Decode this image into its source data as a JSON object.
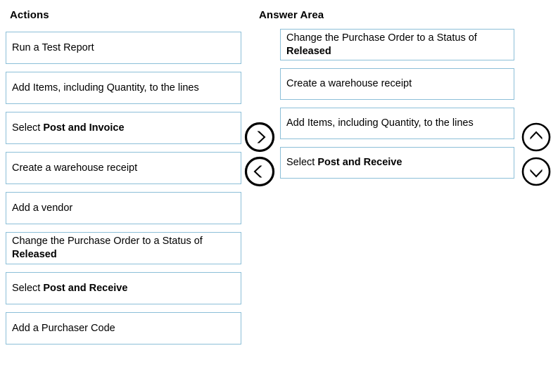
{
  "headings": {
    "actions": "Actions",
    "answer_area": "Answer Area"
  },
  "colors": {
    "box_border": "#8cbfd8",
    "background": "#ffffff",
    "text": "#000000",
    "arrow_stroke": "#000000"
  },
  "actions": {
    "items": [
      {
        "prefix": "Run a Test Report",
        "bold": "",
        "suffix": ""
      },
      {
        "prefix": "Add Items, including Quantity, to the lines",
        "bold": "",
        "suffix": ""
      },
      {
        "prefix": "Select ",
        "bold": "Post and Invoice",
        "suffix": ""
      },
      {
        "prefix": "Create a warehouse receipt",
        "bold": "",
        "suffix": ""
      },
      {
        "prefix": "Add a vendor",
        "bold": "",
        "suffix": ""
      },
      {
        "prefix": "Change the Purchase Order to a Status of ",
        "bold": "Released",
        "suffix": ""
      },
      {
        "prefix": "Select ",
        "bold": "Post and Receive",
        "suffix": ""
      },
      {
        "prefix": "Add a Purchaser Code",
        "bold": "",
        "suffix": ""
      }
    ]
  },
  "answer_area": {
    "items": [
      {
        "prefix": "Change the Purchase Order to a Status of ",
        "bold": "Released",
        "suffix": ""
      },
      {
        "prefix": "Create a warehouse receipt",
        "bold": "",
        "suffix": ""
      },
      {
        "prefix": "Add Items, including Quantity, to the lines",
        "bold": "",
        "suffix": ""
      },
      {
        "prefix": "Select ",
        "bold": "Post and Receive",
        "suffix": ""
      }
    ]
  },
  "buttons": {
    "move_right": {
      "icon": "chevron-right-icon",
      "label": "Move to answer area"
    },
    "move_left": {
      "icon": "chevron-left-icon",
      "label": "Move back to actions"
    },
    "move_up": {
      "icon": "chevron-up-icon",
      "label": "Move item up"
    },
    "move_down": {
      "icon": "chevron-down-icon",
      "label": "Move item down"
    }
  }
}
